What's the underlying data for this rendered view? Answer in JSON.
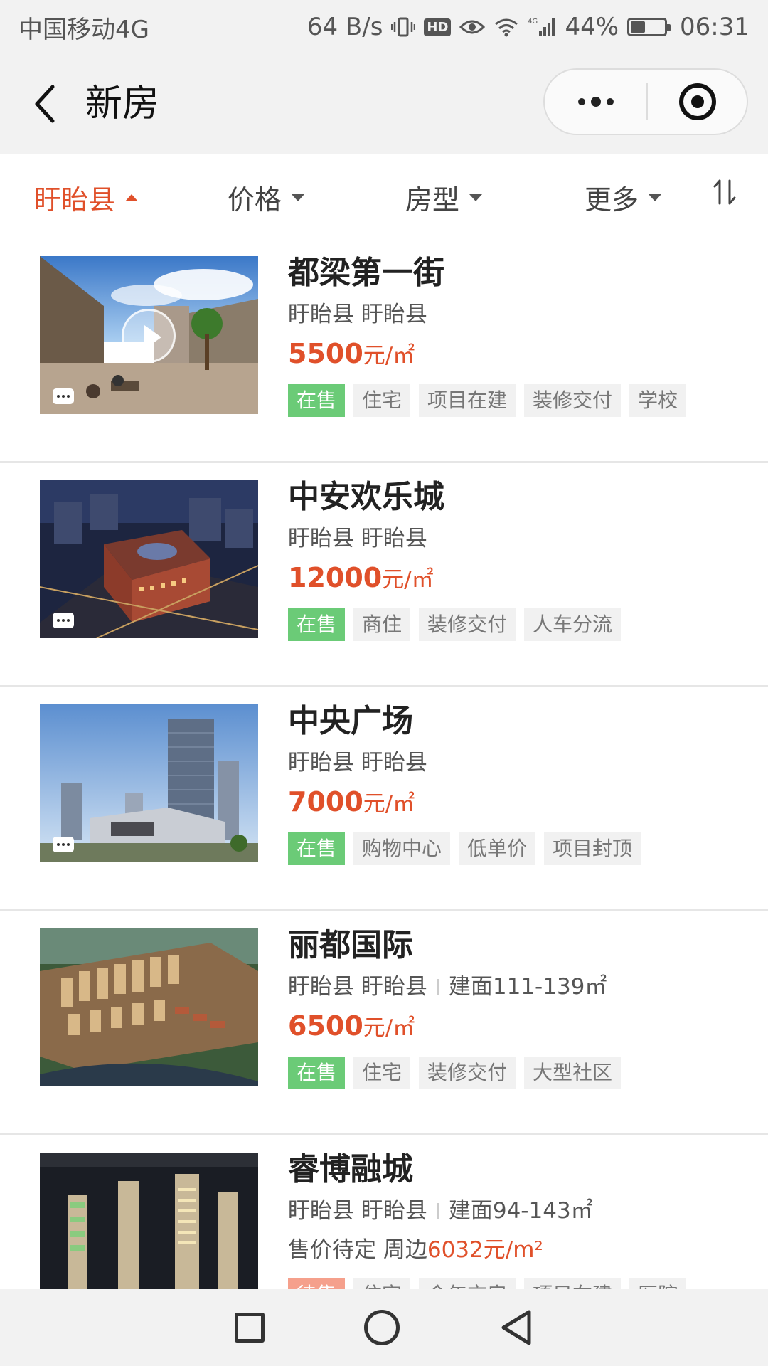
{
  "status_bar": {
    "carrier": "中国移动4G",
    "net_speed": "64 B/s",
    "hd_label": "HD",
    "signal_label": "4G",
    "battery_percent": "44%",
    "battery_level": 0.44,
    "time": "06:31",
    "icons": [
      "vibrate-icon",
      "hd-icon",
      "eye-icon",
      "wifi-icon",
      "signal-icon",
      "battery-icon"
    ]
  },
  "nav": {
    "title": "新房",
    "back_icon": "chevron-left-icon",
    "more_icon": "more-dots-icon",
    "close_icon": "target-icon"
  },
  "filters": [
    {
      "label": "盱眙县",
      "active": true
    },
    {
      "label": "价格",
      "active": false
    },
    {
      "label": "房型",
      "active": false
    },
    {
      "label": "更多",
      "active": false
    }
  ],
  "sort_icon": "sort-icon",
  "listings": [
    {
      "name": "都梁第一街",
      "location": "盱眙县 盱眙县",
      "area": "",
      "price_value": "5500",
      "price_unit": "元/㎡",
      "tags": [
        "在售",
        "住宅",
        "项目在建",
        "装修交付",
        "学校"
      ],
      "has_video": true
    },
    {
      "name": "中安欢乐城",
      "location": "盱眙县 盱眙县",
      "area": "",
      "price_value": "12000",
      "price_unit": "元/㎡",
      "tags": [
        "在售",
        "商住",
        "装修交付",
        "人车分流"
      ],
      "has_video": false
    },
    {
      "name": "中央广场",
      "location": "盱眙县 盱眙县",
      "area": "",
      "price_value": "7000",
      "price_unit": "元/㎡",
      "tags": [
        "在售",
        "购物中心",
        "低单价",
        "项目封顶"
      ],
      "has_video": false
    },
    {
      "name": "丽都国际",
      "location": "盱眙县 盱眙县",
      "area": "建面111-139㎡",
      "price_value": "6500",
      "price_unit": "元/㎡",
      "tags": [
        "在售",
        "住宅",
        "装修交付",
        "大型社区"
      ],
      "has_video": false
    },
    {
      "name": "睿博融城",
      "location": "盱眙县 盱眙县",
      "area": "建面94-143㎡",
      "price_pending": "售价待定 周边",
      "price_around": "6032元/m²",
      "tags": [
        "待售",
        "住宅",
        "今年交房",
        "项目在建",
        "医院"
      ],
      "has_video": false
    }
  ],
  "android_nav": {
    "icons": [
      "recent-apps-icon",
      "home-icon",
      "back-triangle-icon"
    ]
  },
  "colors": {
    "accent": "#e0502a",
    "on_sale": "#6bcb77",
    "upcoming": "#f5a08c",
    "tag_bg": "#f1f1f1",
    "bar_bg": "#f2f2f2"
  }
}
